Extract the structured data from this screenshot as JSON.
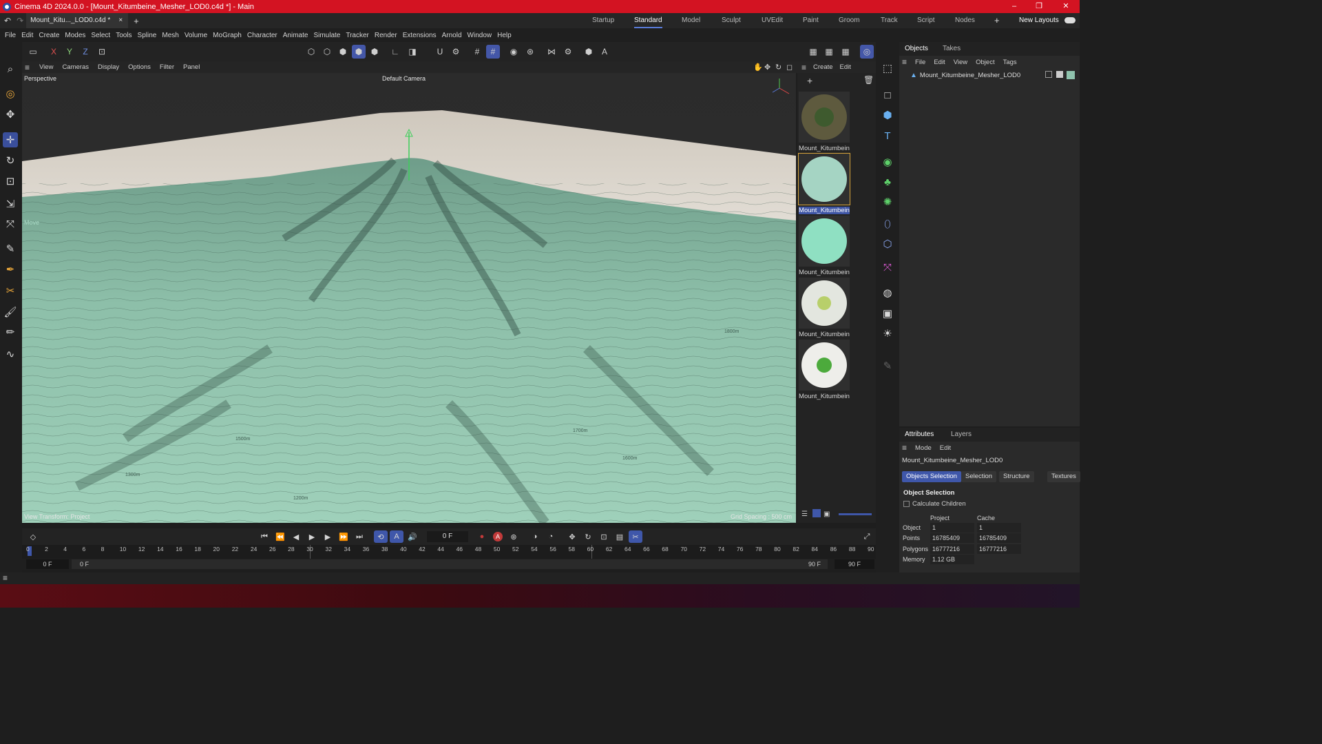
{
  "window": {
    "title": "Cinema 4D 2024.0.0 - [Mount_Kitumbeine_Mesher_LOD0.c4d *] - Main",
    "controls": [
      "–",
      "❐",
      "✕"
    ]
  },
  "tabs": {
    "document": "Mount_Kitu..._LOD0.c4d *",
    "close": "×",
    "add": "+",
    "layouts": [
      "Startup",
      "Standard",
      "Model",
      "Sculpt",
      "UVEdit",
      "Paint",
      "Groom",
      "Track",
      "Script",
      "Nodes"
    ],
    "active_layout": "Standard",
    "new_layouts": "New Layouts"
  },
  "menu": [
    "File",
    "Edit",
    "Create",
    "Modes",
    "Select",
    "Tools",
    "Spline",
    "Mesh",
    "Volume",
    "MoGraph",
    "Character",
    "Animate",
    "Simulate",
    "Tracker",
    "Render",
    "Extensions",
    "Arnold",
    "Window",
    "Help"
  ],
  "axis_buttons": [
    "X",
    "Y",
    "Z"
  ],
  "viewport": {
    "menu": [
      "View",
      "Cameras",
      "Display",
      "Options",
      "Filter",
      "Panel"
    ],
    "projection": "Perspective",
    "camera": "Default Camera",
    "move_label": "Move",
    "view_transform": "View Transform: Project",
    "grid_spacing": "Grid Spacing : 500 cm",
    "contours": [
      "1800m",
      "1700m",
      "1600m",
      "1500m",
      "1300m",
      "1200m"
    ]
  },
  "materials": {
    "menu": [
      "Create",
      "Edit"
    ],
    "items": [
      {
        "label": "Mount_Kitumbein",
        "color": "#5e5a3e"
      },
      {
        "label": "Mount_Kitumbein",
        "color": "#a5d4c3"
      },
      {
        "label": "Mount_Kitumbein",
        "color": "#8fe0c2"
      },
      {
        "label": "Mount_Kitumbein",
        "color": "#e3e6df"
      },
      {
        "label": "Mount_Kitumbein",
        "color": "#eeeeea"
      }
    ]
  },
  "objects": {
    "tabs": [
      "Objects",
      "Takes"
    ],
    "menu": [
      "File",
      "Edit",
      "View",
      "Object",
      "Tags"
    ],
    "items": [
      {
        "name": "Mount_Kitumbeine_Mesher_LOD0"
      }
    ]
  },
  "attributes": {
    "tabs": [
      "Attributes",
      "Layers"
    ],
    "menu": [
      "Mode",
      "Edit"
    ],
    "object_name": "Mount_Kitumbeine_Mesher_LOD0",
    "buttons": [
      "Objects Selection",
      "Selection",
      "Structure",
      "Textures"
    ],
    "section": "Object Selection",
    "calculate_children": "Calculate Children",
    "columns": [
      "Project",
      "Cache"
    ],
    "rows": [
      {
        "label": "Object",
        "project": "1",
        "cache": "1"
      },
      {
        "label": "Points",
        "project": "16785409",
        "cache": "16785409"
      },
      {
        "label": "Polygons",
        "project": "16777216",
        "cache": "16777216"
      },
      {
        "label": "Memory",
        "project": "1.12 GB",
        "cache": ""
      }
    ]
  },
  "timeline": {
    "current_frame": "0 F",
    "ticks": [
      "0",
      "2",
      "4",
      "6",
      "8",
      "10",
      "12",
      "14",
      "16",
      "18",
      "20",
      "22",
      "24",
      "26",
      "28",
      "30",
      "32",
      "34",
      "36",
      "38",
      "40",
      "42",
      "44",
      "46",
      "48",
      "50",
      "52",
      "54",
      "56",
      "58",
      "60",
      "62",
      "64",
      "66",
      "68",
      "70",
      "72",
      "74",
      "76",
      "78",
      "80",
      "82",
      "84",
      "86",
      "88",
      "90"
    ],
    "range_start": "0 F",
    "range_start2": "0 F",
    "range_end": "90 F",
    "range_end2": "90 F"
  },
  "colors": {
    "titlebar": "#d31322",
    "accent": "#3f57aa",
    "terrain": "#8fc3ad",
    "terrain_dark": "#2f4a40",
    "ground": "#d8d2c8"
  }
}
